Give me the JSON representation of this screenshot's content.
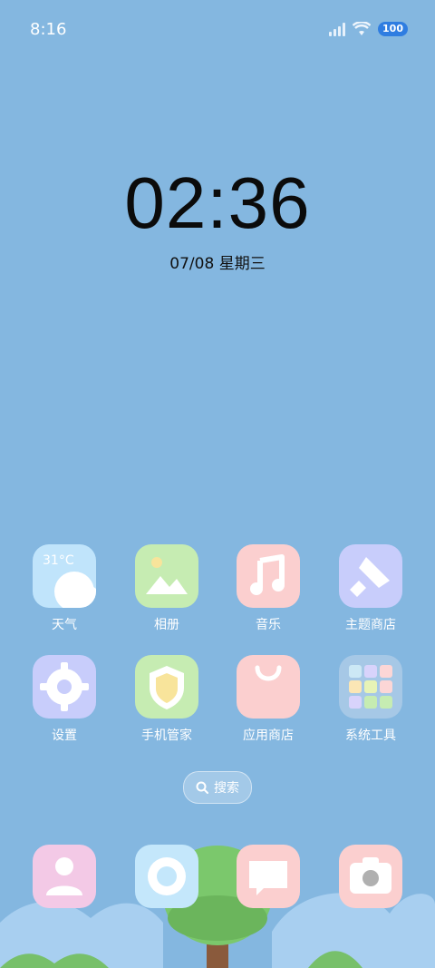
{
  "status_bar": {
    "time": "8:16",
    "battery": "100"
  },
  "clock": {
    "time": "02:36",
    "date": "07/08 星期三"
  },
  "apps": [
    {
      "label": "天气",
      "color": "#bfe4fb",
      "temp": "31°C"
    },
    {
      "label": "相册",
      "color": "#c6ecb2"
    },
    {
      "label": "音乐",
      "color": "#fbcfcf"
    },
    {
      "label": "主题商店",
      "color": "#c8cdfb"
    },
    {
      "label": "设置",
      "color": "#c8cdfb"
    },
    {
      "label": "手机管家",
      "color": "#c6ecb2"
    },
    {
      "label": "应用商店",
      "color": "#fbcfcf"
    },
    {
      "label": "系统工具",
      "color": "#a6c8e6"
    }
  ],
  "search": {
    "label": "搜索"
  },
  "dock": [
    {
      "name": "contacts",
      "color": "#f3c9e6"
    },
    {
      "name": "browser",
      "color": "#c4e7fb"
    },
    {
      "name": "messages",
      "color": "#fbcfcf"
    },
    {
      "name": "camera",
      "color": "#fbcfcf"
    }
  ]
}
